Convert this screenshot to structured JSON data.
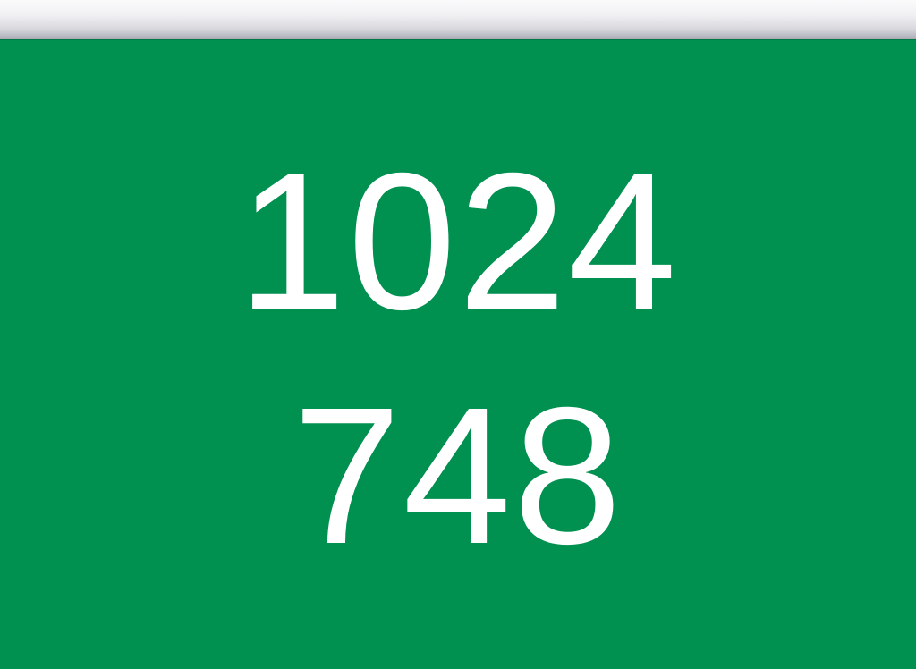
{
  "screen": {
    "background_color": "#009050",
    "text_color": "#ffffff"
  },
  "top_bar": {
    "style": "light-gray-gradient"
  },
  "dimensions": {
    "width_label": "1024",
    "height_label": "748"
  }
}
